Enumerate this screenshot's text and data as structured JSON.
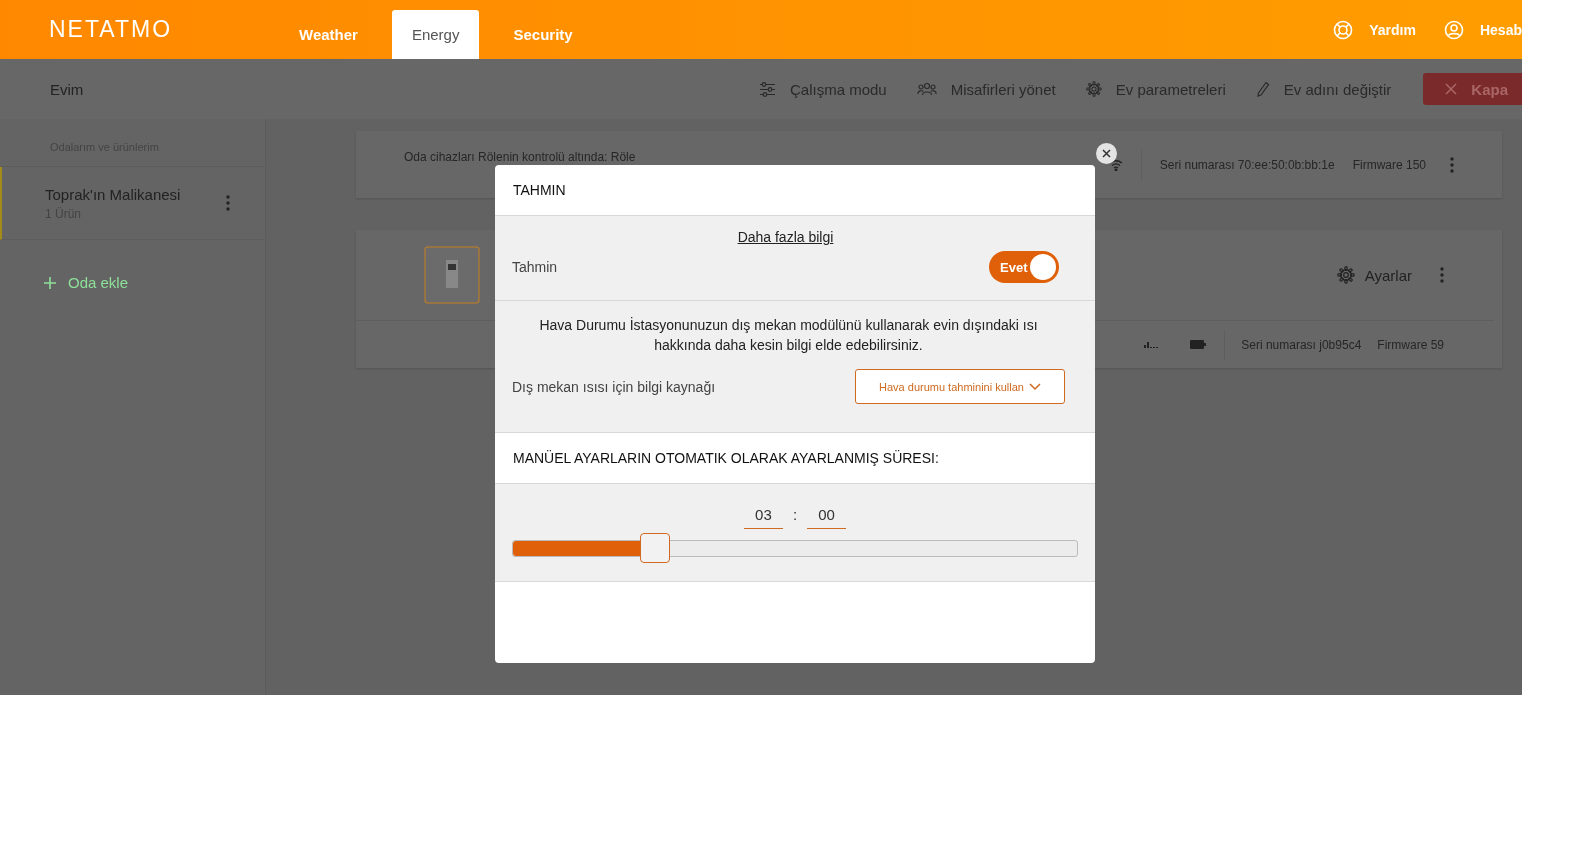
{
  "header": {
    "logo": "NETATMO",
    "tabs": [
      {
        "label": "Weather",
        "selected": false
      },
      {
        "label": "Energy",
        "selected": true
      },
      {
        "label": "Security",
        "selected": false
      }
    ],
    "links": [
      {
        "kind": "help",
        "label": "Yardım"
      },
      {
        "kind": "account",
        "label": "Hesab"
      }
    ]
  },
  "toolbar": {
    "title": "Evim",
    "actions": [
      {
        "kind": "mode",
        "label": "Çalışma modu"
      },
      {
        "kind": "guests",
        "label": "Misafirleri yönet"
      },
      {
        "kind": "settings",
        "label": "Ev parametreleri"
      },
      {
        "kind": "rename",
        "label": "Ev adını değiştir"
      }
    ],
    "close_button": "Kapa"
  },
  "sidebar": {
    "heading": "Odalarım ve ürünlerim",
    "rooms": [
      {
        "name": "Toprak'ın Malikanesi",
        "count": "1 Ürün",
        "selected": true
      }
    ],
    "add_room": "Oda ekle"
  },
  "devices": [
    {
      "kind": "relay",
      "note": "Oda cihazları Rölenin kontrolü altında: Röle",
      "serial": "Seri numarası 70:ee:50:0b:bb:1e",
      "firmware": "Firmware 150"
    },
    {
      "kind": "thermostat",
      "settings": "Ayarlar",
      "serial": "Seri numarası j0b95c4",
      "firmware": "Firmware 59"
    }
  ],
  "dialog": {
    "title": "TAHMIN",
    "more_info": "Daha fazla bilgi",
    "toggle": {
      "label": "Tahmin",
      "on": true,
      "on_text": "Evet"
    },
    "description": "Hava Durumu İstasyonunuzun dış mekan modülünü kullanarak evin dışındaki ısı hakkında daha kesin bilgi elde edebilirsiniz.",
    "source": {
      "label": "Dış mekan ısısı için bilgi kaynağı",
      "value": "Hava durumu tahminini kullan"
    },
    "duration_heading": "MANÜEL AYARLARIN OTOMATIK OLARAK AYARLANMIŞ SÜRESI:",
    "hours": "03",
    "separator": ":",
    "minutes": "00",
    "slider": {
      "level": 0.25
    }
  }
}
